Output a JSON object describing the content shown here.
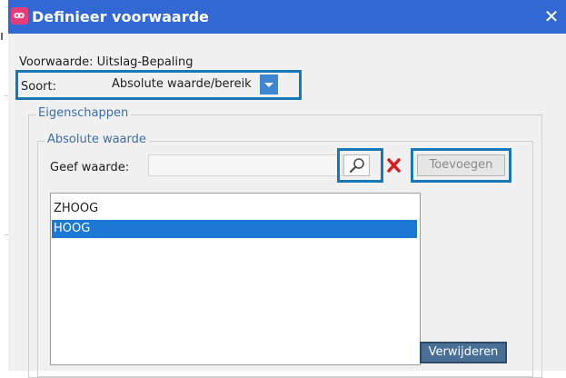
{
  "window": {
    "title": "Definieer voorwaarde",
    "icon": "app-logo-icon",
    "close_glyph": "✕"
  },
  "form": {
    "voorwaarde_label": "Voorwaarde:",
    "voorwaarde_value": "Uitslag-Bepaling",
    "soort_label": "Soort:",
    "soort_value": "Absolute waarde/bereik"
  },
  "eigenschappen": {
    "title": "Eigenschappen",
    "absolute_waarde": {
      "title": "Absolute waarde",
      "geef_waarde_label": "Geef waarde:",
      "geef_waarde_value": "",
      "add_button": "Toevoegen",
      "list_items": [
        "ZHOOG",
        "HOOG"
      ],
      "selected_index": 1,
      "remove_button": "Verwijderen"
    }
  },
  "colors": {
    "titlebar": "#3268d3",
    "highlight": "#1777b8",
    "selection": "#1c78d4",
    "clear_icon": "#e01919"
  }
}
